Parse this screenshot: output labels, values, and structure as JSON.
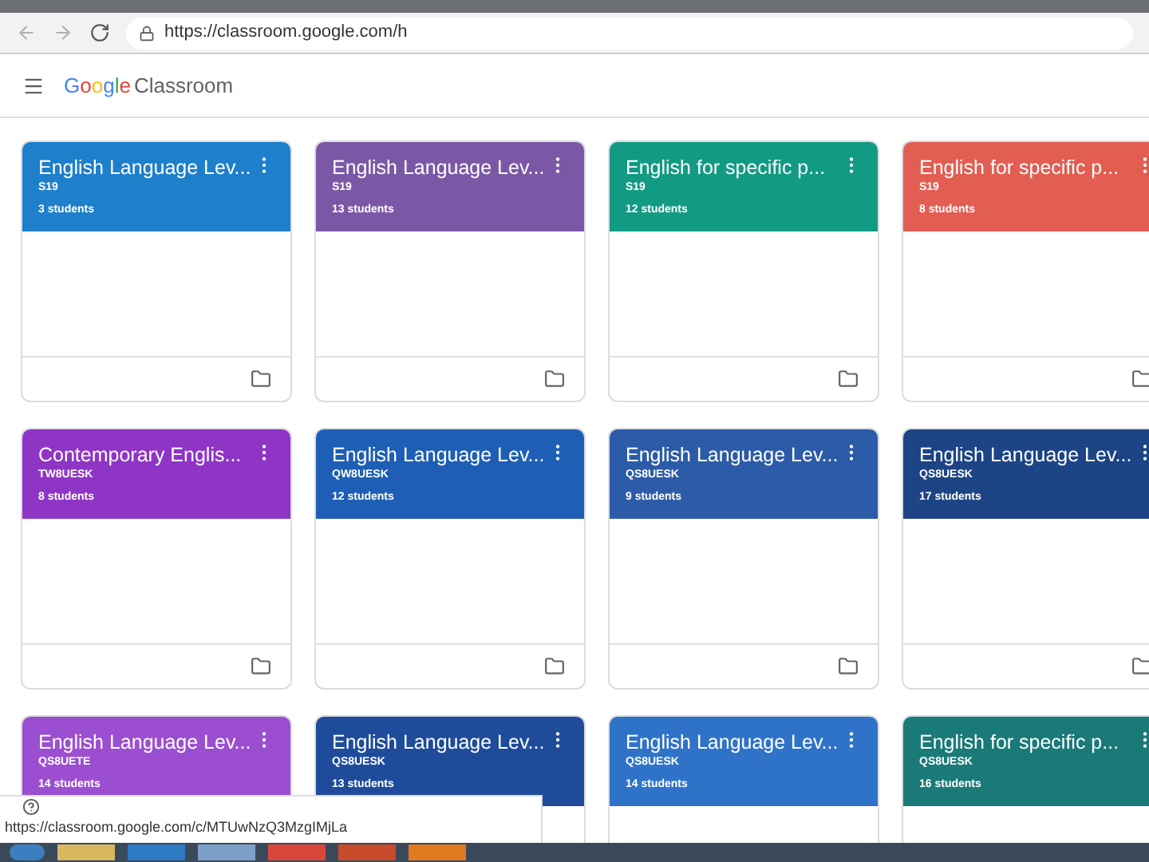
{
  "browser": {
    "url": "https://classroom.google.com/h"
  },
  "app": {
    "brand": "Google",
    "product": "Classroom"
  },
  "classes": [
    {
      "title": "English Language Lev...",
      "section": "S19",
      "students": "3 students",
      "color": "#1e7fcb"
    },
    {
      "title": "English Language Lev...",
      "section": "S19",
      "students": "13 students",
      "color": "#7b58a6"
    },
    {
      "title": "English for specific p...",
      "section": "S19",
      "students": "12 students",
      "color": "#129a83"
    },
    {
      "title": "English for specific p...",
      "section": "S19",
      "students": "8 students",
      "color": "#e25e52"
    },
    {
      "title": "Contemporary Englis...",
      "section": "TW8UESK",
      "students": "8 students",
      "color": "#8f35c5"
    },
    {
      "title": "English Language Lev...",
      "section": "QW8UESK",
      "students": "12 students",
      "color": "#1e5fb5"
    },
    {
      "title": "English Language Lev...",
      "section": "QS8UESK",
      "students": "9 students",
      "color": "#2c5ca8"
    },
    {
      "title": "English Language Lev...",
      "section": "QS8UESK",
      "students": "17 students",
      "color": "#1d4485"
    },
    {
      "title": "English Language Lev...",
      "section": "QS8UETE",
      "students": "14 students",
      "color": "#9b4fd0"
    },
    {
      "title": "English Language Lev...",
      "section": "QS8UESK",
      "students": "13 students",
      "color": "#1f4c9a"
    },
    {
      "title": "English Language Lev...",
      "section": "QS8UESK",
      "students": "14 students",
      "color": "#2f73c8"
    },
    {
      "title": "English for specific p...",
      "section": "QS8UESK",
      "students": "16 students",
      "color": "#1a7a78"
    }
  ],
  "status_bar": {
    "url": "https://classroom.google.com/c/MTUwNzQ3MzgIMjLa"
  }
}
